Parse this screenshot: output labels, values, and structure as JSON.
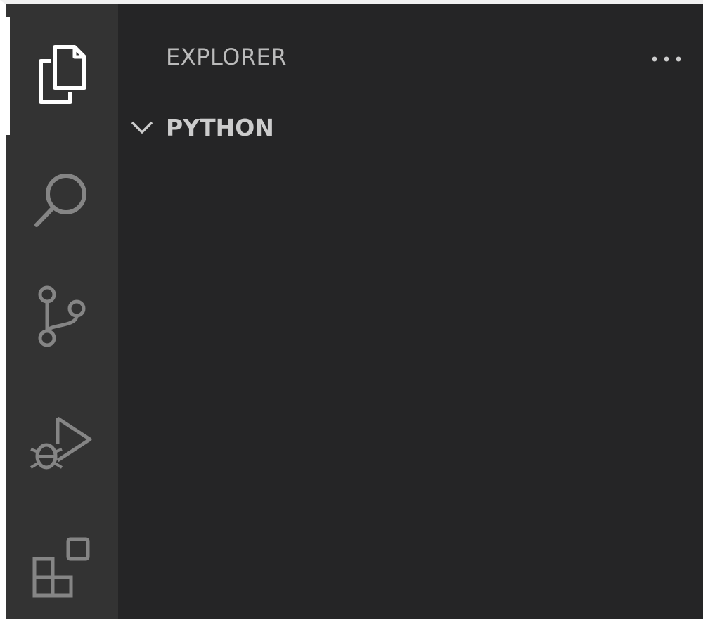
{
  "activity_bar": {
    "items": [
      {
        "id": "explorer",
        "icon": "files-icon",
        "active": true
      },
      {
        "id": "search",
        "icon": "search-icon",
        "active": false
      },
      {
        "id": "source-control",
        "icon": "source-control-icon",
        "active": false
      },
      {
        "id": "run-debug",
        "icon": "run-debug-icon",
        "active": false
      },
      {
        "id": "extensions",
        "icon": "extensions-icon",
        "active": false
      }
    ]
  },
  "sidebar": {
    "title": "EXPLORER",
    "more_actions_icon": "ellipsis-icon",
    "section": {
      "label": "PYTHON",
      "expanded": true,
      "chevron_icon": "chevron-down-icon"
    }
  },
  "colors": {
    "activity_bar_bg": "#333333",
    "sidebar_bg": "#252526",
    "icon_active": "#ffffff",
    "icon_inactive": "#858585",
    "title_text": "#bbbbbb",
    "section_text": "#cccccc"
  }
}
